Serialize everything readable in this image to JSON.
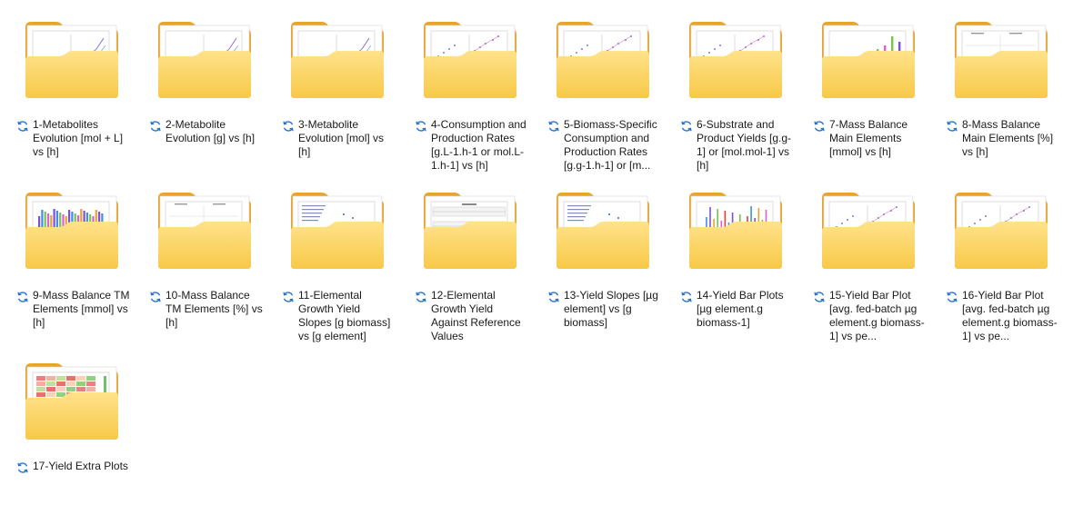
{
  "folders": [
    {
      "label": "1-Metabolites Evolution [mol + L] vs [h]",
      "preview": "line"
    },
    {
      "label": "2-Metabolite Evolution [g] vs [h]",
      "preview": "line"
    },
    {
      "label": "3-Metabolite Evolution [mol] vs [h]",
      "preview": "line"
    },
    {
      "label": "4-Consumption and Production Rates [g.L-1.h-1 or mol.L-1.h-1] vs [h]",
      "preview": "scatter"
    },
    {
      "label": "5-Biomass-Specific Consumption and Production Rates [g.g-1.h-1] or [m...",
      "preview": "scatter"
    },
    {
      "label": "6-Substrate and Product Yields [g.g-1] or [mol.mol-1] vs [h]",
      "preview": "scatter"
    },
    {
      "label": "7-Mass Balance Main Elements [mmol] vs [h]",
      "preview": "bars"
    },
    {
      "label": "8-Mass Balance Main Elements [%] vs [h]",
      "preview": "blank"
    },
    {
      "label": "9-Mass Balance TM Elements [mmol] vs [h]",
      "preview": "denseBars"
    },
    {
      "label": "10-Mass Balance TM Elements [%] vs [h]",
      "preview": "blank"
    },
    {
      "label": "11-Elemental Growth Yield Slopes [g biomass] vs [g element]",
      "preview": "text"
    },
    {
      "label": "12-Elemental Growth Yield Against Reference Values",
      "preview": "boxes"
    },
    {
      "label": "13-Yield Slopes [µg element] vs [g biomass]",
      "preview": "text"
    },
    {
      "label": "14-Yield Bar Plots [µg element.g biomass-1]",
      "preview": "colorBars"
    },
    {
      "label": "15-Yield Bar Plot [avg. fed-batch µg element.g biomass-1] vs pe...",
      "preview": "scatter"
    },
    {
      "label": "16-Yield Bar Plot [avg. fed-batch µg element.g biomass-1] vs pe...",
      "preview": "scatter"
    },
    {
      "label": "17-Yield Extra Plots",
      "preview": "heat"
    }
  ],
  "colors": {
    "folder_back": "#E9A42C",
    "folder_front_top": "#FFE28A",
    "folder_front_bottom": "#F8C948",
    "sync_icon": "#1E6FD0"
  }
}
